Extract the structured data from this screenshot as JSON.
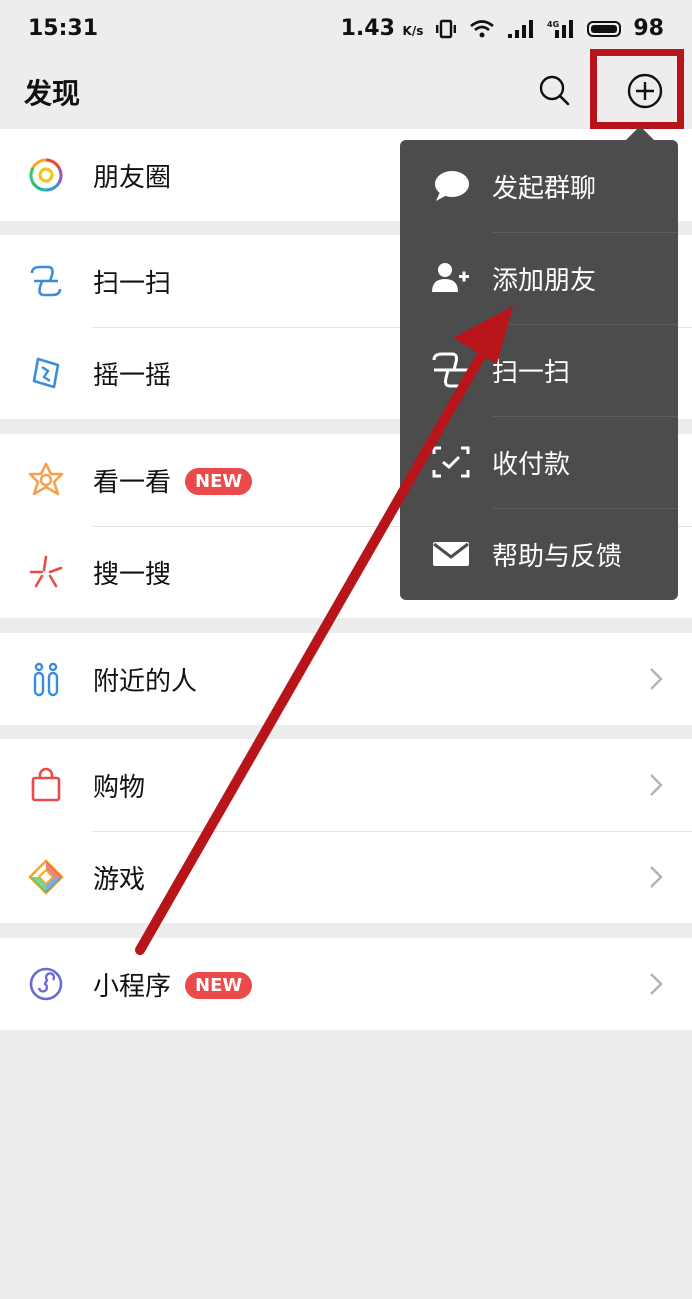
{
  "status_bar": {
    "time": "15:31",
    "speed": "1.43",
    "speed_unit": "K/s",
    "battery": "98"
  },
  "header": {
    "title": "发现"
  },
  "sections": [
    {
      "items": [
        {
          "label": "朋友圈",
          "icon": "moments-icon"
        }
      ]
    },
    {
      "items": [
        {
          "label": "扫一扫",
          "icon": "scan-icon"
        },
        {
          "label": "摇一摇",
          "icon": "shake-icon"
        }
      ]
    },
    {
      "items": [
        {
          "label": "看一看",
          "icon": "top-stories-icon",
          "badge": "NEW"
        },
        {
          "label": "搜一搜",
          "icon": "search-feature-icon"
        }
      ]
    },
    {
      "items": [
        {
          "label": "附近的人",
          "icon": "people-nearby-icon"
        }
      ]
    },
    {
      "items": [
        {
          "label": "购物",
          "icon": "shopping-bag-icon"
        },
        {
          "label": "游戏",
          "icon": "games-icon"
        }
      ]
    },
    {
      "items": [
        {
          "label": "小程序",
          "icon": "mini-program-icon",
          "badge": "NEW"
        }
      ]
    }
  ],
  "popup_menu": {
    "items": [
      {
        "label": "发起群聊",
        "icon": "chat-bubble-icon"
      },
      {
        "label": "添加朋友",
        "icon": "add-friend-icon"
      },
      {
        "label": "扫一扫",
        "icon": "scan-icon"
      },
      {
        "label": "收付款",
        "icon": "pay-icon"
      },
      {
        "label": "帮助与反馈",
        "icon": "mail-icon"
      }
    ]
  },
  "colors": {
    "background": "#ededed",
    "menu_bg": "#4c4c4c",
    "badge_red": "#ec4a4a",
    "annotation_red": "#b8151b"
  }
}
